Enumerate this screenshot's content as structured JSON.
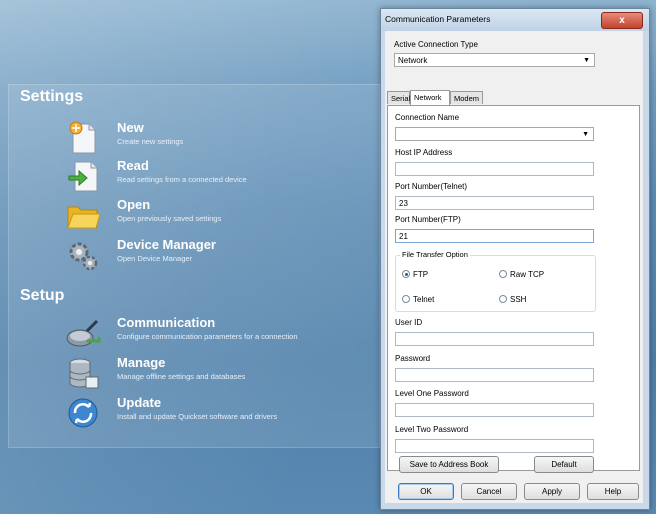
{
  "left": {
    "sections": {
      "settings": "Settings",
      "setup": "Setup"
    },
    "items": [
      {
        "title": "New",
        "desc": "Create new settings",
        "icon": "new-settings-icon"
      },
      {
        "title": "Read",
        "desc": "Read settings from a connected device",
        "icon": "read-device-icon"
      },
      {
        "title": "Open",
        "desc": "Open previously saved settings",
        "icon": "open-folder-icon"
      },
      {
        "title": "Device Manager",
        "desc": "Open Device Manager",
        "icon": "device-manager-icon"
      },
      {
        "title": "Communication",
        "desc": "Configure communication parameters for a connection",
        "icon": "communication-icon"
      },
      {
        "title": "Manage",
        "desc": "Manage offline settings and databases",
        "icon": "database-icon"
      },
      {
        "title": "Update",
        "desc": "Install and update Quickset software and drivers",
        "icon": "update-icon"
      }
    ]
  },
  "dialog": {
    "title": "Communication Parameters",
    "close_label": "x",
    "active_type_label": "Active Connection Type",
    "active_type_value": "Network",
    "tabs": [
      "Serial",
      "Network",
      "Modem"
    ],
    "active_tab": "Network",
    "connection_name_label": "Connection Name",
    "connection_name_value": "",
    "host_ip_label": "Host IP Address",
    "host_ip_value": "",
    "port_telnet_label": "Port Number(Telnet)",
    "port_telnet_value": "23",
    "port_ftp_label": "Port Number(FTP)",
    "port_ftp_value": "21",
    "file_transfer": {
      "label": "File Transfer Option",
      "options": [
        "FTP",
        "Raw TCP",
        "Telnet",
        "SSH"
      ],
      "selected": "FTP"
    },
    "user_id_label": "User ID",
    "password_label": "Password",
    "level_one_label": "Level One Password",
    "level_two_label": "Level Two Password",
    "save_address_book": "Save to Address Book",
    "default_btn": "Default",
    "ok": "OK",
    "cancel": "Cancel",
    "apply": "Apply",
    "help": "Help"
  }
}
